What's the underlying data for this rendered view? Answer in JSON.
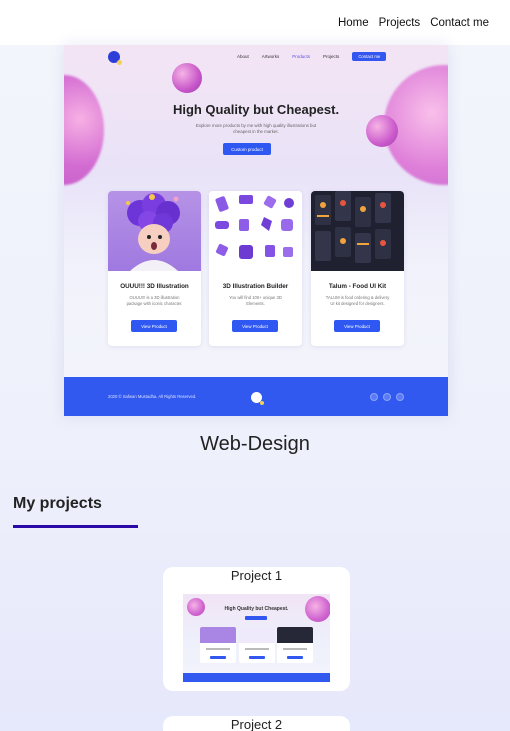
{
  "nav": {
    "items": [
      "Home",
      "Projects",
      "Contact me"
    ]
  },
  "preview": {
    "nav_items": [
      "About",
      "Artworks",
      "Products",
      "Projects"
    ],
    "active_item": "Products",
    "cta": "Contact me",
    "title": "High Quality but Cheapest.",
    "subtitle": "Explore more products by me with high quality illustrations but cheapest in the market.",
    "button": "Custom product",
    "cards": [
      {
        "title": "OUUU!!! 3D Illustration",
        "desc": "OUUU!!! is a 3D illustration package with iconic character.",
        "button": "View Product"
      },
      {
        "title": "3D Illustration Builder",
        "desc": "You will find 100+ unique 3D Elements.",
        "button": "View Product"
      },
      {
        "title": "Talum - Food UI Kit",
        "desc": "TALUM is food ordering & delivery UI kit designed for designers.",
        "button": "View Product"
      }
    ],
    "footer_copy": "2020 © Safwan Mustadha. All Rights Reserved."
  },
  "caption": "Web-Design",
  "section": {
    "title": "My projects"
  },
  "projects": [
    {
      "title": "Project 1"
    },
    {
      "title": "Project 2"
    }
  ],
  "colors": {
    "accent": "#3159f0",
    "underline": "#2a0aa6",
    "blob": "#d26bd2"
  }
}
